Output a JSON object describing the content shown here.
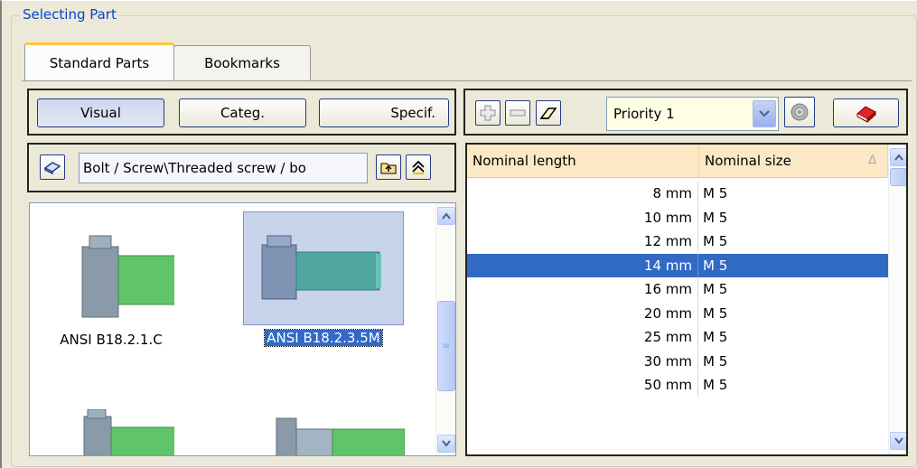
{
  "group_title": "Selecting Part",
  "tabs": [
    {
      "label": "Standard Parts",
      "active": true
    },
    {
      "label": "Bookmarks",
      "active": false
    }
  ],
  "view_buttons": [
    {
      "label": "Visual",
      "pressed": true
    },
    {
      "label": "Categ.",
      "pressed": false
    },
    {
      "label": "Specif.",
      "pressed": false
    }
  ],
  "path": {
    "value": "Bolt / Screw\\Threaded screw / bo"
  },
  "toolbar": {
    "priority_value": "Priority 1",
    "icons": [
      "add-icon",
      "remove-icon",
      "eraser-icon",
      "dropdown-arrow-icon",
      "target-icon",
      "book-icon"
    ]
  },
  "parts": [
    {
      "label": "ANSI B18.2.1.C",
      "selected": false
    },
    {
      "label": "ANSI B18.2.3.5M",
      "selected": true
    },
    {
      "label": "",
      "selected": false
    },
    {
      "label": "",
      "selected": false
    }
  ],
  "table": {
    "columns": [
      "Nominal length",
      "Nominal size"
    ],
    "sort_indicator": "∆",
    "rows": [
      {
        "length": "8 mm",
        "size": "M 5",
        "selected": false
      },
      {
        "length": "10 mm",
        "size": "M 5",
        "selected": false
      },
      {
        "length": "12 mm",
        "size": "M 5",
        "selected": false
      },
      {
        "length": "14 mm",
        "size": "M 5",
        "selected": true
      },
      {
        "length": "16 mm",
        "size": "M 5",
        "selected": false
      },
      {
        "length": "20 mm",
        "size": "M 5",
        "selected": false
      },
      {
        "length": "25 mm",
        "size": "M 5",
        "selected": false
      },
      {
        "length": "30 mm",
        "size": "M 5",
        "selected": false
      },
      {
        "length": "50 mm",
        "size": "M 5",
        "selected": false
      }
    ]
  },
  "colors": {
    "selection": "#316ac5",
    "header_bg": "#fce8c4",
    "bolt_green": "#5fc46a",
    "bolt_gray": "#8a9aa8"
  }
}
